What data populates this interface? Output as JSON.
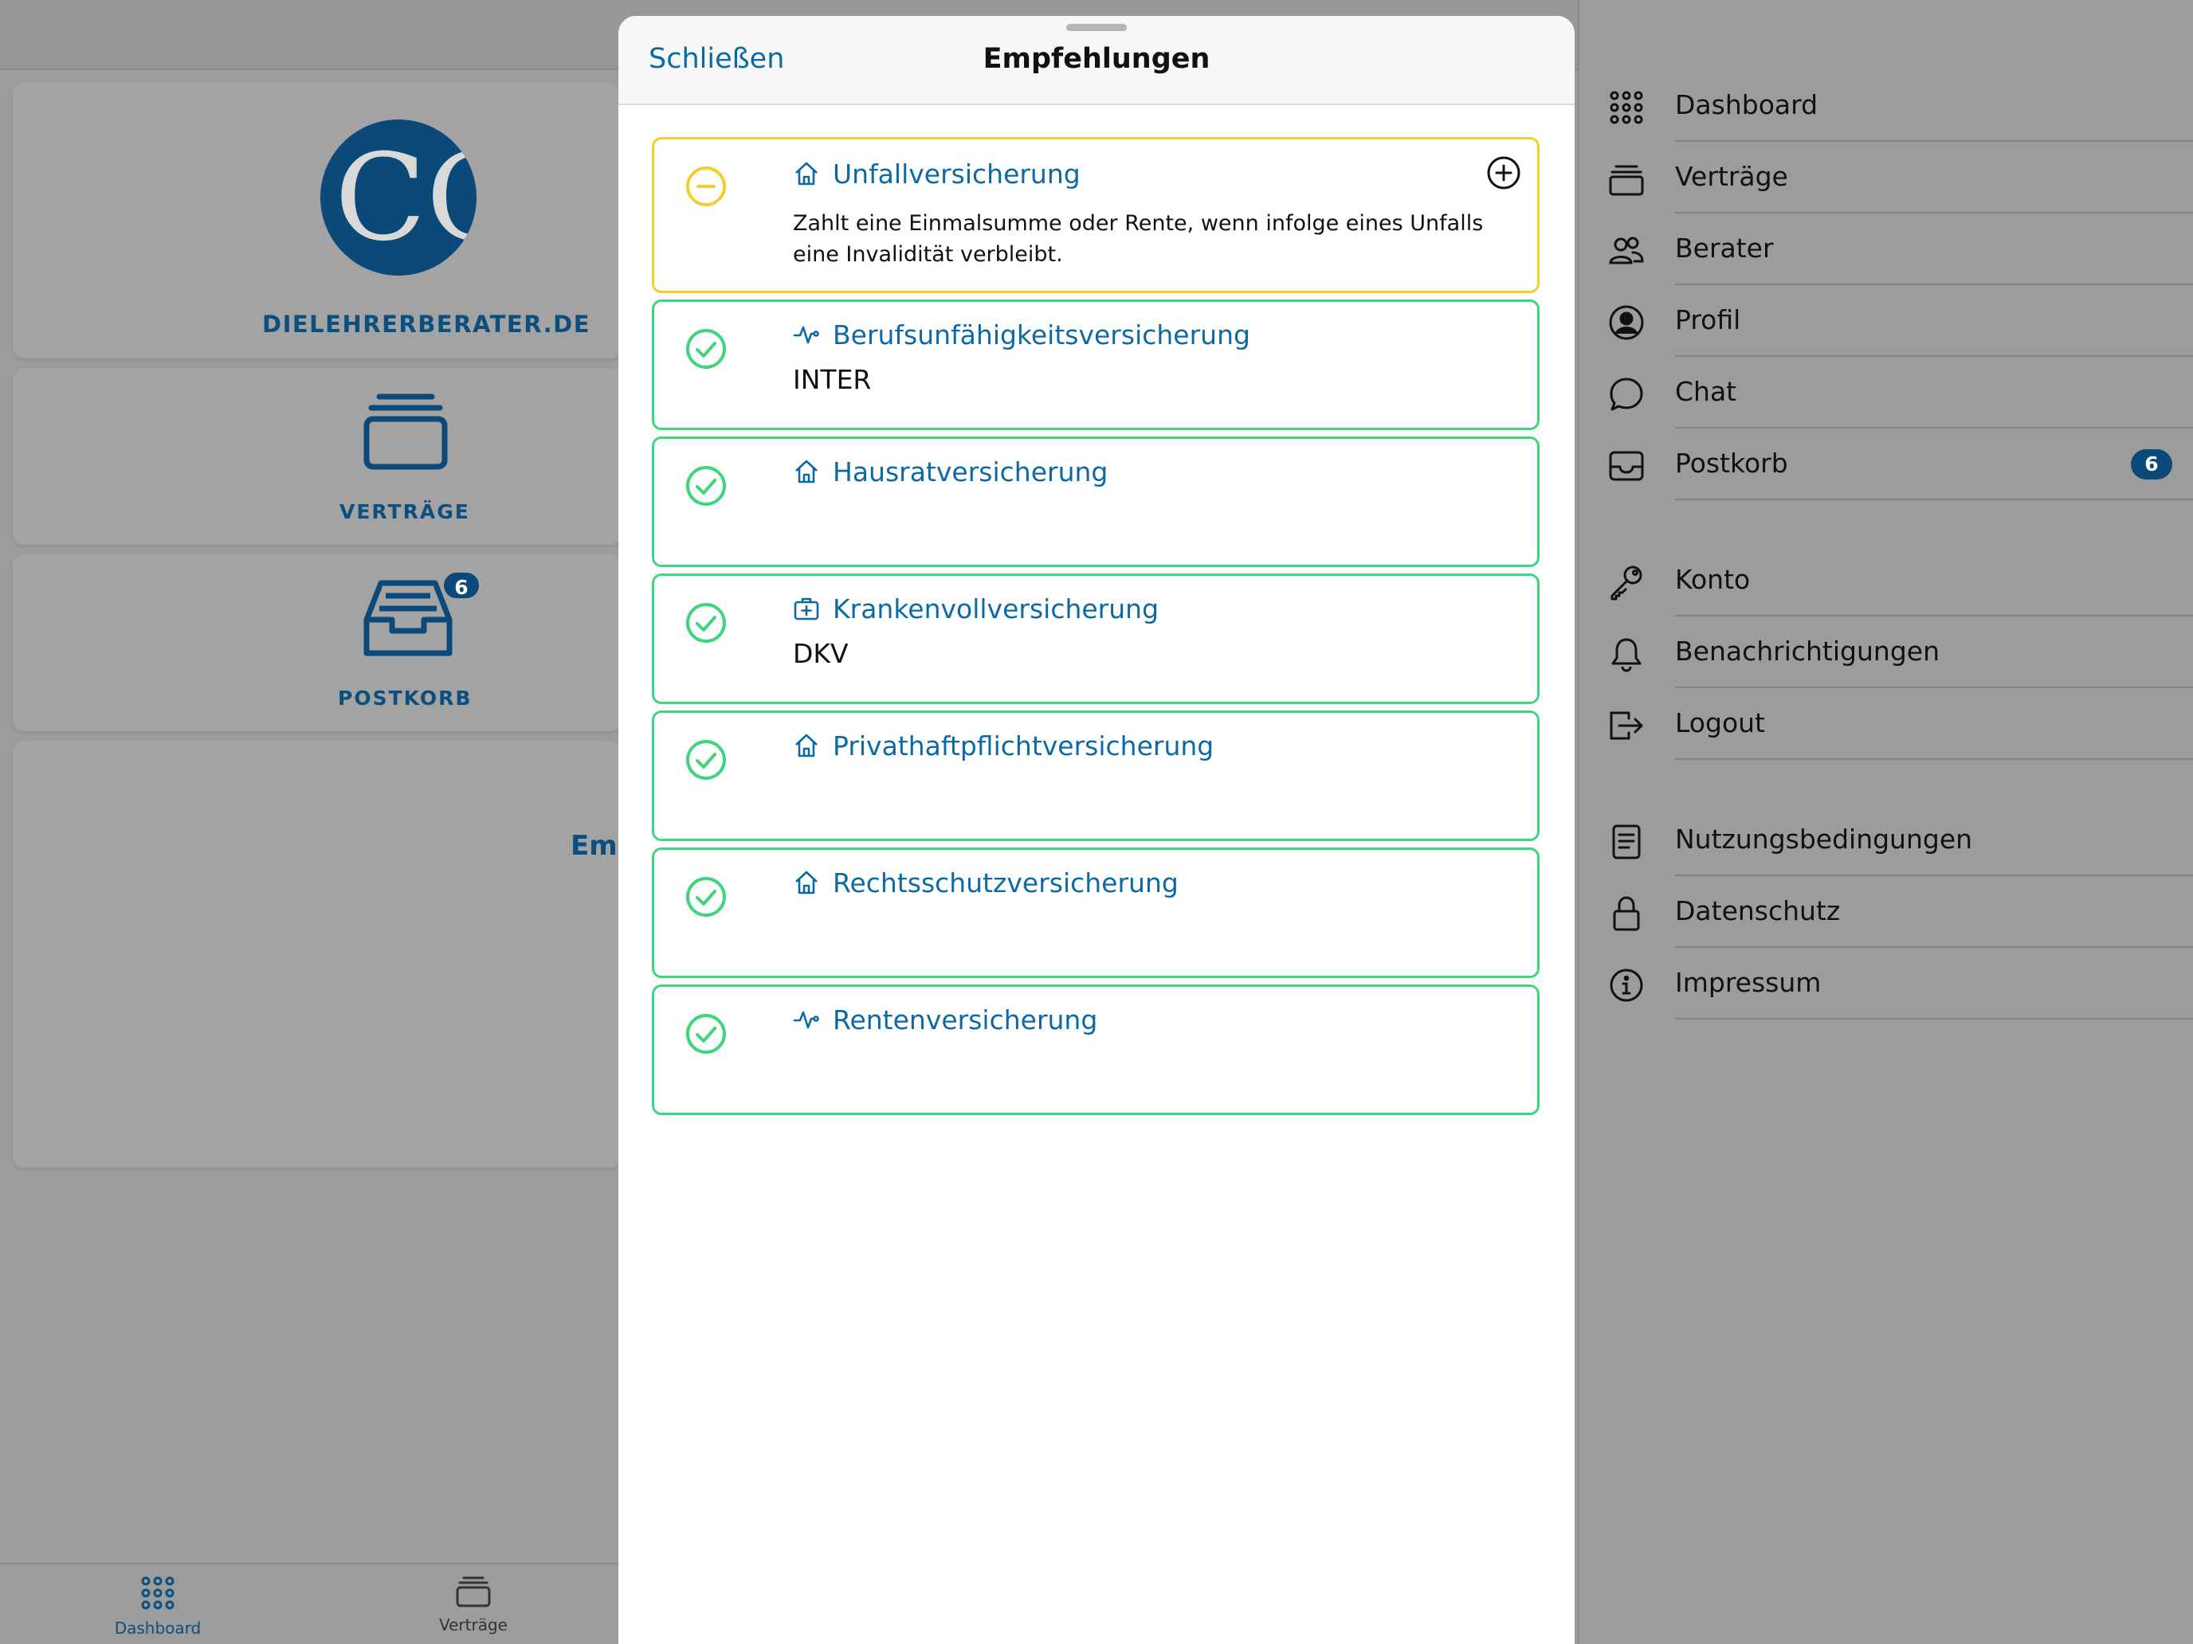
{
  "app": {
    "brand": "DIELEHRERBERATER.DE",
    "logo_text": "CC"
  },
  "dashboard": {
    "tiles": [
      {
        "label": "VERTRÄGE",
        "icon": "contracts-icon"
      },
      {
        "label": "POSTKORB",
        "icon": "inbox-icon",
        "badge": "6"
      }
    ],
    "recommendations_title": "Empfehlungen"
  },
  "tabbar": {
    "tabs": [
      {
        "label": "Dashboard",
        "icon": "grid-dots-icon",
        "active": true
      },
      {
        "label": "Verträge",
        "icon": "contracts-icon",
        "active": false
      }
    ]
  },
  "sidebar": {
    "items": [
      {
        "label": "Dashboard",
        "icon": "grid-dots-icon"
      },
      {
        "label": "Verträge",
        "icon": "contracts-icon"
      },
      {
        "label": "Berater",
        "icon": "people-icon"
      },
      {
        "label": "Profil",
        "icon": "user-circle-icon"
      },
      {
        "label": "Chat",
        "icon": "chat-bubble-icon"
      },
      {
        "label": "Postkorb",
        "icon": "inbox-icon",
        "badge": "6"
      },
      {
        "label": "Konto",
        "icon": "key-icon"
      },
      {
        "label": "Benachrichtigungen",
        "icon": "bell-icon"
      },
      {
        "label": "Logout",
        "icon": "logout-icon"
      },
      {
        "label": "Nutzungsbedingungen",
        "icon": "document-icon"
      },
      {
        "label": "Datenschutz",
        "icon": "lock-icon"
      },
      {
        "label": "Impressum",
        "icon": "info-icon"
      }
    ]
  },
  "modal": {
    "close_label": "Schließen",
    "title": "Empfehlungen",
    "recommendations": [
      {
        "title": "Unfallversicherung",
        "status": "pending",
        "type_icon": "house-icon",
        "description": "Zahlt eine Einmalsumme oder Rente, wenn infolge eines Unfalls eine Invalidität verbleibt.",
        "company": ""
      },
      {
        "title": "Berufsunfähigkeitsversicherung",
        "status": "done",
        "type_icon": "pulse-icon",
        "company": "INTER"
      },
      {
        "title": "Hausratversicherung",
        "status": "done",
        "type_icon": "house-icon",
        "company": ""
      },
      {
        "title": "Krankenvollversicherung",
        "status": "done",
        "type_icon": "medical-case-icon",
        "company": "DKV"
      },
      {
        "title": "Privathaftpflichtversicherung",
        "status": "done",
        "type_icon": "house-icon",
        "company": ""
      },
      {
        "title": "Rechtsschutzversicherung",
        "status": "done",
        "type_icon": "house-icon",
        "company": ""
      },
      {
        "title": "Rentenversicherung",
        "status": "done",
        "type_icon": "pulse-icon",
        "company": ""
      }
    ]
  },
  "colors": {
    "accent": "#0b6aa6",
    "brand_dark": "#0b4a78",
    "done": "#3ed67c",
    "pending": "#f2cf2c"
  }
}
